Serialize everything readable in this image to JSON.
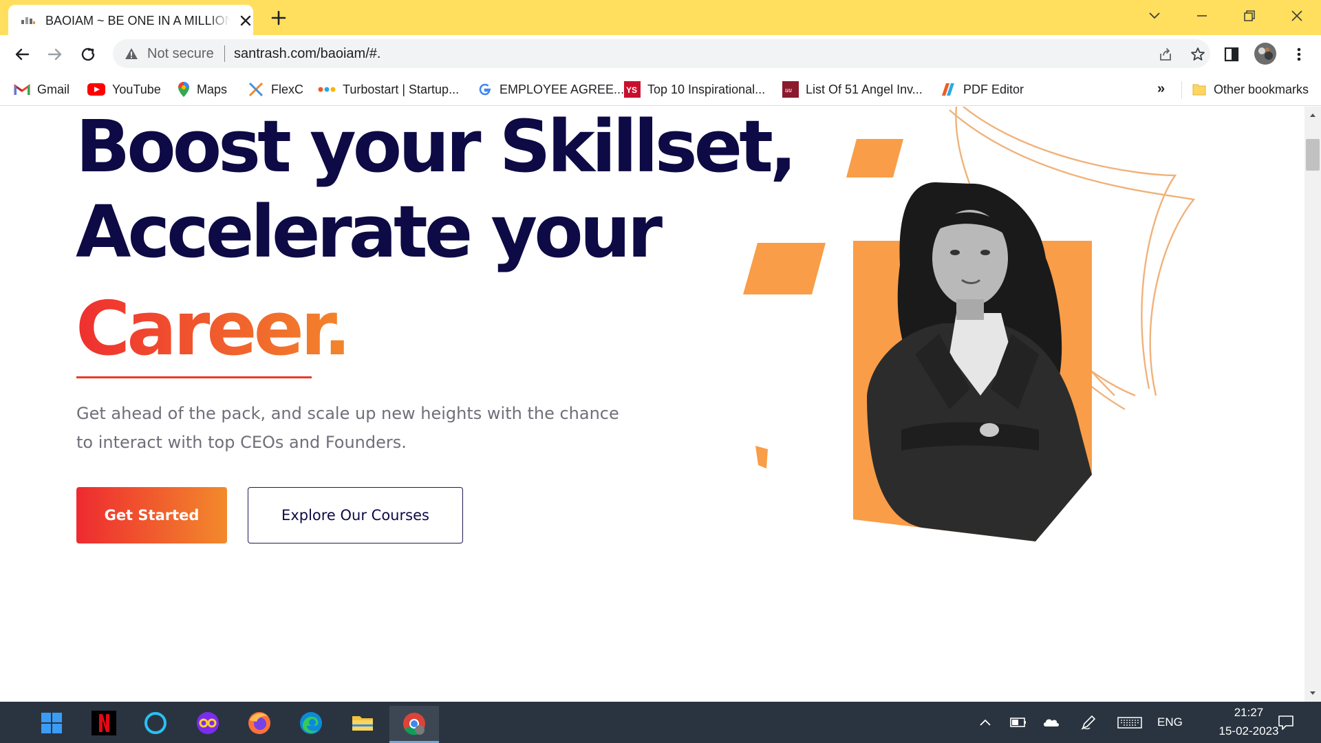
{
  "browser": {
    "tab_title": "BAOIAM ~ BE ONE IN A MILLION",
    "security_label": "Not secure",
    "url": "santrash.com/baoiam/#."
  },
  "bookmarks": [
    {
      "label": "Gmail",
      "icon": "gmail-icon"
    },
    {
      "label": "YouTube",
      "icon": "youtube-icon"
    },
    {
      "label": "Maps",
      "icon": "maps-icon"
    },
    {
      "label": "FlexC",
      "icon": "flexc-icon"
    },
    {
      "label": "Turbostart | Startup...",
      "icon": "turbostart-icon"
    },
    {
      "label": "EMPLOYEE AGREE...",
      "icon": "google-icon"
    },
    {
      "label": "Top 10 Inspirational...",
      "icon": "ys-icon"
    },
    {
      "label": "List Of 51 Angel Inv...",
      "icon": "angel-icon"
    },
    {
      "label": "PDF Editor",
      "icon": "pdf-editor-icon"
    }
  ],
  "bookmarks_more": "»",
  "other_bookmarks": "Other bookmarks",
  "hero": {
    "line1": "Boost your Skillset,",
    "line2": "Accelerate your",
    "line3": "Career.",
    "subtitle": "Get ahead of the pack, and scale up new heights with the chance to interact with top CEOs and Founders.",
    "primary_button": "Get Started",
    "secondary_button": "Explore Our Courses"
  },
  "taskbar": {
    "language": "ENG",
    "time": "21:27",
    "date": "15-02-2023"
  },
  "colors": {
    "chrome_frame": "#ffdf5d",
    "heading_navy": "#0d0a45",
    "accent_red": "#ef2f2f",
    "accent_orange": "#f2862b",
    "shape_orange": "#f99d48",
    "taskbar": "#2a3440"
  }
}
